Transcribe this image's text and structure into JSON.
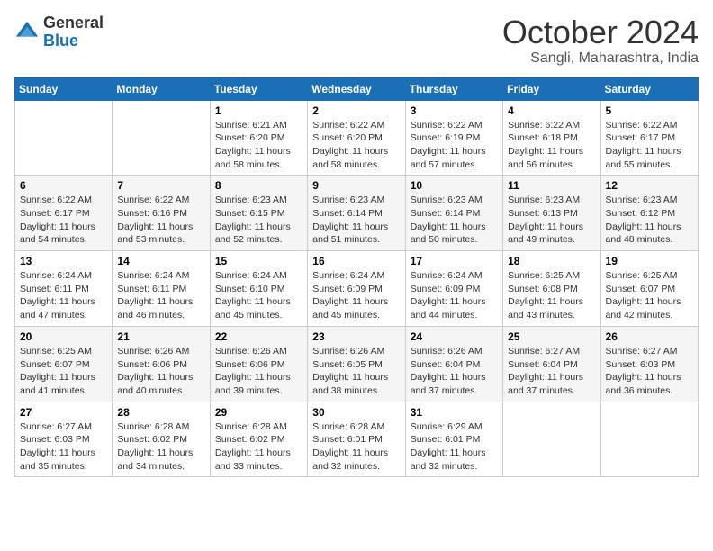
{
  "header": {
    "logo": {
      "general": "General",
      "blue": "Blue"
    },
    "title": "October 2024",
    "location": "Sangli, Maharashtra, India"
  },
  "weekdays": [
    "Sunday",
    "Monday",
    "Tuesday",
    "Wednesday",
    "Thursday",
    "Friday",
    "Saturday"
  ],
  "weeks": [
    [
      {
        "day": null
      },
      {
        "day": null
      },
      {
        "day": "1",
        "sunrise": "6:21 AM",
        "sunset": "6:20 PM",
        "daylight": "11 hours and 58 minutes."
      },
      {
        "day": "2",
        "sunrise": "6:22 AM",
        "sunset": "6:20 PM",
        "daylight": "11 hours and 58 minutes."
      },
      {
        "day": "3",
        "sunrise": "6:22 AM",
        "sunset": "6:19 PM",
        "daylight": "11 hours and 57 minutes."
      },
      {
        "day": "4",
        "sunrise": "6:22 AM",
        "sunset": "6:18 PM",
        "daylight": "11 hours and 56 minutes."
      },
      {
        "day": "5",
        "sunrise": "6:22 AM",
        "sunset": "6:17 PM",
        "daylight": "11 hours and 55 minutes."
      }
    ],
    [
      {
        "day": "6",
        "sunrise": "6:22 AM",
        "sunset": "6:17 PM",
        "daylight": "11 hours and 54 minutes."
      },
      {
        "day": "7",
        "sunrise": "6:22 AM",
        "sunset": "6:16 PM",
        "daylight": "11 hours and 53 minutes."
      },
      {
        "day": "8",
        "sunrise": "6:23 AM",
        "sunset": "6:15 PM",
        "daylight": "11 hours and 52 minutes."
      },
      {
        "day": "9",
        "sunrise": "6:23 AM",
        "sunset": "6:14 PM",
        "daylight": "11 hours and 51 minutes."
      },
      {
        "day": "10",
        "sunrise": "6:23 AM",
        "sunset": "6:14 PM",
        "daylight": "11 hours and 50 minutes."
      },
      {
        "day": "11",
        "sunrise": "6:23 AM",
        "sunset": "6:13 PM",
        "daylight": "11 hours and 49 minutes."
      },
      {
        "day": "12",
        "sunrise": "6:23 AM",
        "sunset": "6:12 PM",
        "daylight": "11 hours and 48 minutes."
      }
    ],
    [
      {
        "day": "13",
        "sunrise": "6:24 AM",
        "sunset": "6:11 PM",
        "daylight": "11 hours and 47 minutes."
      },
      {
        "day": "14",
        "sunrise": "6:24 AM",
        "sunset": "6:11 PM",
        "daylight": "11 hours and 46 minutes."
      },
      {
        "day": "15",
        "sunrise": "6:24 AM",
        "sunset": "6:10 PM",
        "daylight": "11 hours and 45 minutes."
      },
      {
        "day": "16",
        "sunrise": "6:24 AM",
        "sunset": "6:09 PM",
        "daylight": "11 hours and 45 minutes."
      },
      {
        "day": "17",
        "sunrise": "6:24 AM",
        "sunset": "6:09 PM",
        "daylight": "11 hours and 44 minutes."
      },
      {
        "day": "18",
        "sunrise": "6:25 AM",
        "sunset": "6:08 PM",
        "daylight": "11 hours and 43 minutes."
      },
      {
        "day": "19",
        "sunrise": "6:25 AM",
        "sunset": "6:07 PM",
        "daylight": "11 hours and 42 minutes."
      }
    ],
    [
      {
        "day": "20",
        "sunrise": "6:25 AM",
        "sunset": "6:07 PM",
        "daylight": "11 hours and 41 minutes."
      },
      {
        "day": "21",
        "sunrise": "6:26 AM",
        "sunset": "6:06 PM",
        "daylight": "11 hours and 40 minutes."
      },
      {
        "day": "22",
        "sunrise": "6:26 AM",
        "sunset": "6:06 PM",
        "daylight": "11 hours and 39 minutes."
      },
      {
        "day": "23",
        "sunrise": "6:26 AM",
        "sunset": "6:05 PM",
        "daylight": "11 hours and 38 minutes."
      },
      {
        "day": "24",
        "sunrise": "6:26 AM",
        "sunset": "6:04 PM",
        "daylight": "11 hours and 37 minutes."
      },
      {
        "day": "25",
        "sunrise": "6:27 AM",
        "sunset": "6:04 PM",
        "daylight": "11 hours and 37 minutes."
      },
      {
        "day": "26",
        "sunrise": "6:27 AM",
        "sunset": "6:03 PM",
        "daylight": "11 hours and 36 minutes."
      }
    ],
    [
      {
        "day": "27",
        "sunrise": "6:27 AM",
        "sunset": "6:03 PM",
        "daylight": "11 hours and 35 minutes."
      },
      {
        "day": "28",
        "sunrise": "6:28 AM",
        "sunset": "6:02 PM",
        "daylight": "11 hours and 34 minutes."
      },
      {
        "day": "29",
        "sunrise": "6:28 AM",
        "sunset": "6:02 PM",
        "daylight": "11 hours and 33 minutes."
      },
      {
        "day": "30",
        "sunrise": "6:28 AM",
        "sunset": "6:01 PM",
        "daylight": "11 hours and 32 minutes."
      },
      {
        "day": "31",
        "sunrise": "6:29 AM",
        "sunset": "6:01 PM",
        "daylight": "11 hours and 32 minutes."
      },
      {
        "day": null
      },
      {
        "day": null
      }
    ]
  ],
  "labels": {
    "sunrise": "Sunrise:",
    "sunset": "Sunset:",
    "daylight": "Daylight:"
  }
}
